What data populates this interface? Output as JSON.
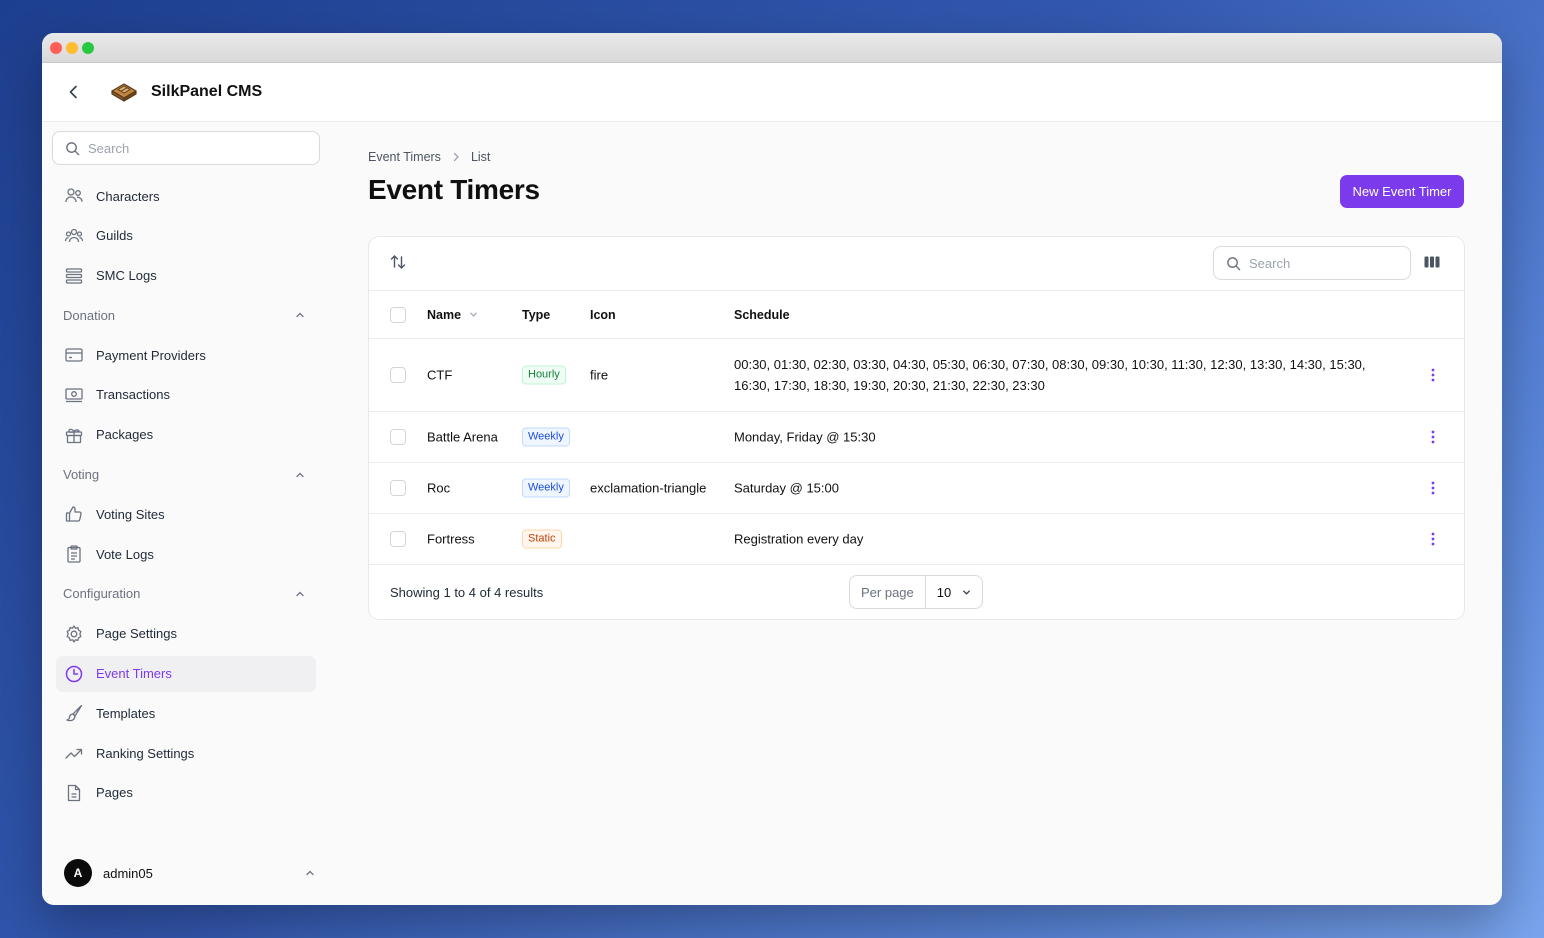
{
  "app": {
    "title": "SilkPanel CMS"
  },
  "sidebar": {
    "search_placeholder": "Search",
    "items": [
      {
        "label": "Characters",
        "icon": "users-icon"
      },
      {
        "label": "Guilds",
        "icon": "user-group-icon"
      },
      {
        "label": "SMC Logs",
        "icon": "list-icon"
      }
    ],
    "groups": [
      {
        "label": "Donation",
        "items": [
          {
            "label": "Payment Providers",
            "icon": "credit-card-icon"
          },
          {
            "label": "Transactions",
            "icon": "banknotes-icon"
          },
          {
            "label": "Packages",
            "icon": "gift-icon"
          }
        ]
      },
      {
        "label": "Voting",
        "items": [
          {
            "label": "Voting Sites",
            "icon": "thumb-up-icon"
          },
          {
            "label": "Vote Logs",
            "icon": "clipboard-icon"
          }
        ]
      },
      {
        "label": "Configuration",
        "items": [
          {
            "label": "Page Settings",
            "icon": "cog-icon"
          },
          {
            "label": "Event Timers",
            "icon": "clock-icon",
            "active": true
          },
          {
            "label": "Templates",
            "icon": "paint-brush-icon"
          },
          {
            "label": "Ranking Settings",
            "icon": "trending-up-icon"
          },
          {
            "label": "Pages",
            "icon": "document-icon"
          }
        ]
      }
    ],
    "user": {
      "initial": "A",
      "name": "admin05"
    }
  },
  "breadcrumb": {
    "parent": "Event Timers",
    "current": "List"
  },
  "page": {
    "title": "Event Timers",
    "new_button": "New Event Timer"
  },
  "table": {
    "search_placeholder": "Search",
    "columns": {
      "name": "Name",
      "type": "Type",
      "icon": "Icon",
      "schedule": "Schedule"
    },
    "rows": [
      {
        "name": "CTF",
        "type": "Hourly",
        "icon": "fire",
        "schedule": "00:30, 01:30, 02:30, 03:30, 04:30, 05:30, 06:30, 07:30, 08:30, 09:30, 10:30, 11:30, 12:30, 13:30, 14:30, 15:30, 16:30, 17:30, 18:30, 19:30, 20:30, 21:30, 22:30, 23:30"
      },
      {
        "name": "Battle Arena",
        "type": "Weekly",
        "icon": "",
        "schedule": "Monday, Friday @ 15:30"
      },
      {
        "name": "Roc",
        "type": "Weekly",
        "icon": "exclamation-triangle",
        "schedule": "Saturday @ 15:00"
      },
      {
        "name": "Fortress",
        "type": "Static",
        "icon": "",
        "schedule": "Registration every day"
      }
    ],
    "footer": {
      "results": "Showing 1 to 4 of 4 results",
      "per_page_label": "Per page",
      "per_page_value": "10"
    }
  },
  "colors": {
    "accent": "#7c3aed",
    "hourly": "#15803d",
    "weekly": "#1d4ed8",
    "static": "#c2410c"
  }
}
